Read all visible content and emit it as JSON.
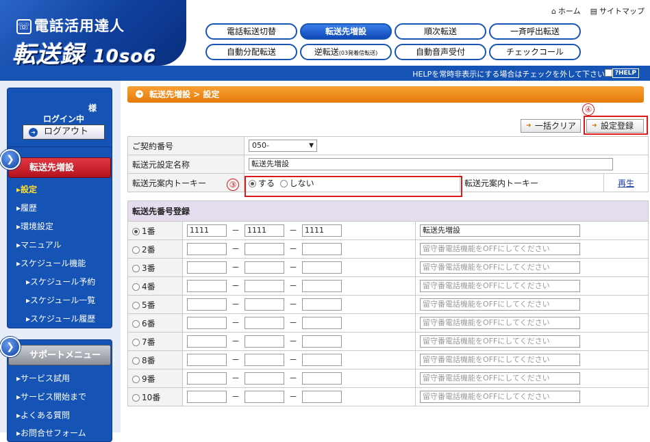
{
  "header": {
    "logo_tagline": "電話活用達人",
    "logo_name": "転送録",
    "logo_sub": "10so6",
    "home_label": "ホーム",
    "sitemap_label": "サイトマップ"
  },
  "nav": {
    "items": [
      {
        "label": "電話転送切替"
      },
      {
        "label": "転送先増設"
      },
      {
        "label": "順次転送"
      },
      {
        "label": "一斉呼出転送"
      },
      {
        "label": "自動分配転送"
      },
      {
        "label": "逆転送",
        "small": "(03発着信転送)"
      },
      {
        "label": "自動音声受付"
      },
      {
        "label": "チェックコール"
      }
    ],
    "active": "転送先増設"
  },
  "helpbar": {
    "text": "HELPを常時非表示にする場合はチェックを外して下さい",
    "button": "?HELP"
  },
  "sidebar": {
    "sama": "様",
    "login_label": "ログイン中",
    "logout_label": "ログアウト",
    "menu1_title": "転送先増設",
    "menu1_items": [
      "設定",
      "履歴",
      "環境設定",
      "マニュアル",
      "スケジュール機能"
    ],
    "schedule_items": [
      "スケジュール予約",
      "スケジュール一覧",
      "スケジュール履歴"
    ],
    "menu2_title": "サポートメニュー",
    "menu2_items": [
      "サービス試用",
      "サービス開始まで",
      "よくある質問",
      "お問合せフォーム"
    ]
  },
  "main": {
    "breadcrumb": "転送先増設 > 設定",
    "annot3": "③",
    "annot4": "④",
    "clear_button": "一括クリア",
    "register_button": "設定登録",
    "contract_label": "ご契約番号",
    "contract_value": "050-",
    "source_name_label": "転送元設定名称",
    "source_name_value": "転送先増設",
    "talkie_label": "転送元案内トーキー",
    "talkie_on": "する",
    "talkie_off": "しない",
    "talkie_label2": "転送元案内トーキー",
    "play_link": "再生",
    "dest_section": "転送先番号登録",
    "rows": [
      {
        "no": "1番",
        "p1": "1111",
        "p2": "1111",
        "p3": "1111",
        "name": "転送先増設",
        "placeholder": ""
      },
      {
        "no": "2番",
        "p1": "",
        "p2": "",
        "p3": "",
        "name": "",
        "placeholder": "留守番電話機能をOFFにしてください"
      },
      {
        "no": "3番",
        "p1": "",
        "p2": "",
        "p3": "",
        "name": "",
        "placeholder": "留守番電話機能をOFFにしてください"
      },
      {
        "no": "4番",
        "p1": "",
        "p2": "",
        "p3": "",
        "name": "",
        "placeholder": "留守番電話機能をOFFにしてください"
      },
      {
        "no": "5番",
        "p1": "",
        "p2": "",
        "p3": "",
        "name": "",
        "placeholder": "留守番電話機能をOFFにしてください"
      },
      {
        "no": "6番",
        "p1": "",
        "p2": "",
        "p3": "",
        "name": "",
        "placeholder": "留守番電話機能をOFFにしてください"
      },
      {
        "no": "7番",
        "p1": "",
        "p2": "",
        "p3": "",
        "name": "",
        "placeholder": "留守番電話機能をOFFにしてください"
      },
      {
        "no": "8番",
        "p1": "",
        "p2": "",
        "p3": "",
        "name": "",
        "placeholder": "留守番電話機能をOFFにしてください"
      },
      {
        "no": "9番",
        "p1": "",
        "p2": "",
        "p3": "",
        "name": "",
        "placeholder": "留守番電話機能をOFFにしてください"
      },
      {
        "no": "10番",
        "p1": "",
        "p2": "",
        "p3": "",
        "name": "",
        "placeholder": "留守番電話機能をOFFにしてください"
      }
    ]
  }
}
